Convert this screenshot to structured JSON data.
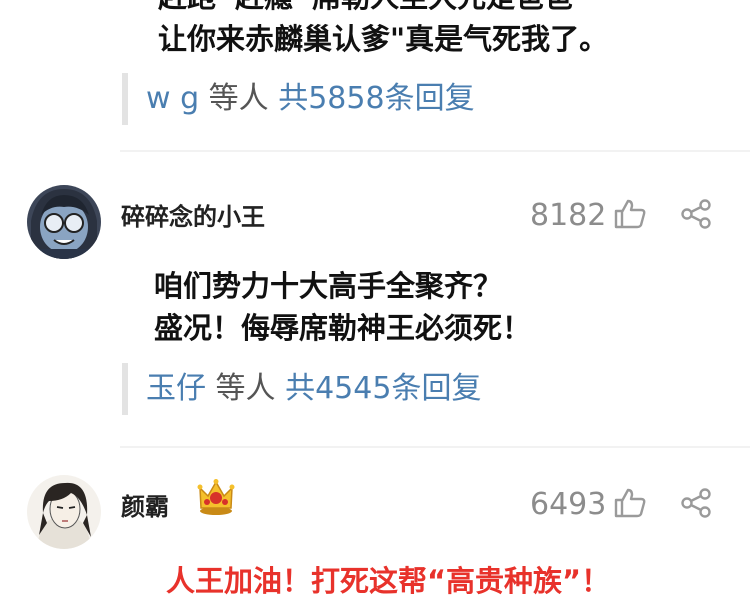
{
  "comments": [
    {
      "text_lines": [
        "赶跑“赶瘾”席勒人至大元是爸爸",
        "让你来赤麟巢认爹\"真是气死我了。"
      ],
      "replies": {
        "users": "w g",
        "mid": "等人",
        "count_text": "共5858条回复"
      }
    },
    {
      "username": "碎碎念的小王",
      "likes": "8182",
      "text_lines": [
        "咱们势力十大高手全聚齐？",
        "盛况！侮辱席勒神王必须死！"
      ],
      "replies": {
        "users": "玉仔",
        "mid": "等人",
        "count_text": "共4545条回复"
      }
    },
    {
      "username": "颜霸",
      "badge": "crown-icon",
      "likes": "6493",
      "text_lines": [
        "人王加油！打死这帮“高贵种族”！"
      ]
    }
  ],
  "colors": {
    "link": "#4a7eb0",
    "highlight_text": "#e8322b",
    "muted": "#8c8c8c"
  }
}
